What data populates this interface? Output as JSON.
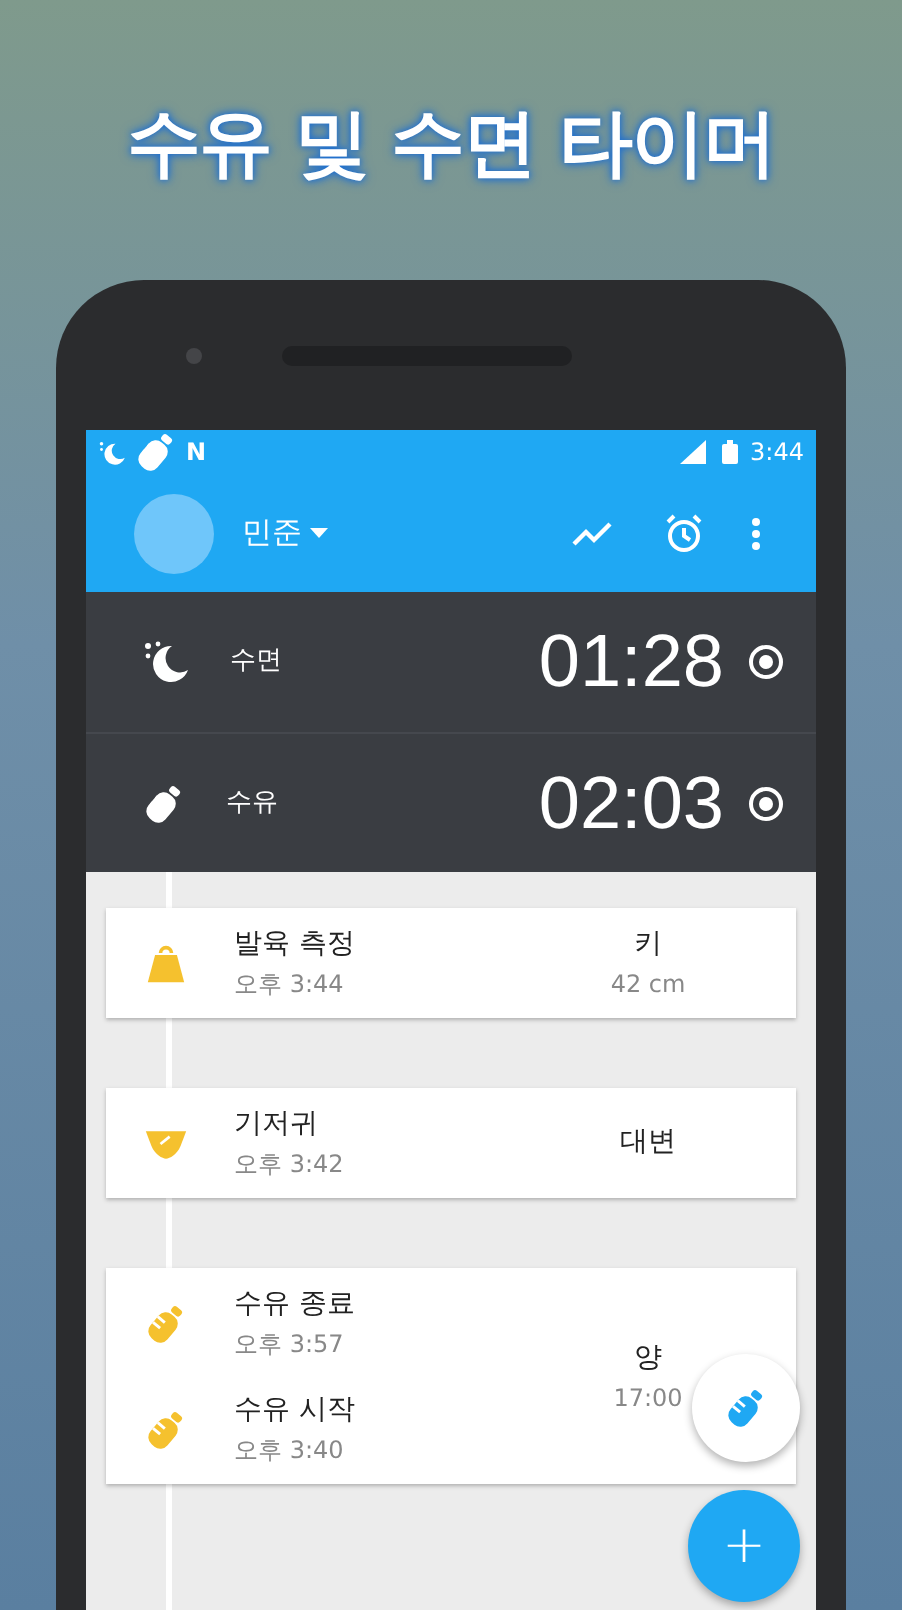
{
  "headline": "수유 및 수면 타이머",
  "status_bar": {
    "time": "3:44",
    "notification_letter": "N"
  },
  "toolbar": {
    "child_name": "민준"
  },
  "timers": [
    {
      "kind": "sleep",
      "label": "수면",
      "time": "01:28"
    },
    {
      "kind": "feeding",
      "label": "수유",
      "time": "02:03"
    }
  ],
  "cards": [
    {
      "entries": [
        {
          "kind": "growth",
          "title": "발육 측정",
          "time": "오후 3:44"
        }
      ],
      "value": "키",
      "detail": "42 cm"
    },
    {
      "entries": [
        {
          "kind": "diaper",
          "title": "기저귀",
          "time": "오후 3:42"
        }
      ],
      "value": "대변"
    },
    {
      "entries": [
        {
          "kind": "feeding",
          "title": "수유 종료",
          "time": "오후 3:57"
        },
        {
          "kind": "feeding",
          "title": "수유 시작",
          "time": "오후 3:40"
        }
      ],
      "value": "양",
      "detail": "17:00"
    }
  ],
  "fab": {
    "label": "+"
  }
}
